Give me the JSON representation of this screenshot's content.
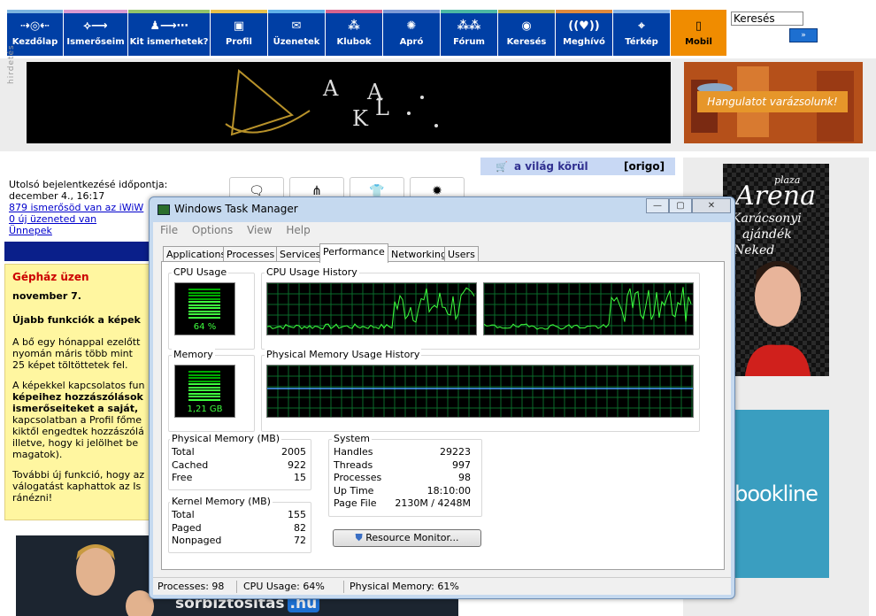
{
  "nav": {
    "items": [
      {
        "label": "Kezdőlap",
        "icon": "home-icon",
        "glyph": "⇢◎⇠"
      },
      {
        "label": "Ismerőseim",
        "icon": "friends-icon",
        "glyph": "⟡⟶"
      },
      {
        "label": "Kit ismerhetek?",
        "icon": "people-network-icon",
        "glyph": "♟⟶⋯"
      },
      {
        "label": "Profil",
        "icon": "profile-icon",
        "glyph": "▣"
      },
      {
        "label": "Üzenetek",
        "icon": "envelope-icon",
        "glyph": "✉"
      },
      {
        "label": "Klubok",
        "icon": "clubs-icon",
        "glyph": "⁂"
      },
      {
        "label": "Apró",
        "icon": "classifieds-icon",
        "glyph": "✺"
      },
      {
        "label": "Fórum",
        "icon": "forum-icon",
        "glyph": "⁂⁂"
      },
      {
        "label": "Keresés",
        "icon": "search-eye-icon",
        "glyph": "◉"
      },
      {
        "label": "Meghívó",
        "icon": "invite-icon",
        "glyph": "((♥))"
      },
      {
        "label": "Térkép",
        "icon": "map-icon",
        "glyph": "⌖"
      },
      {
        "label": "Mobil",
        "icon": "mobile-icon",
        "glyph": "▯"
      }
    ],
    "stripe_colors": [
      "#7bb3df",
      "#d99ad0",
      "#92c46a",
      "#e8c14a",
      "#5fb0e8",
      "#d6658e",
      "#7d9ad6",
      "#4cb8a3",
      "#b6b04a",
      "#e08a3c",
      "#8ab6e6",
      "#f08c00"
    ]
  },
  "search": {
    "value": "Keresés",
    "button": "»"
  },
  "ads": {
    "side_label": "hirdetés",
    "banner_left_text": [
      "A",
      "A",
      "K",
      "L"
    ],
    "banner_right_text": "Hangulatot varázsolunk!",
    "arena_text": "Arena",
    "arena_sub": "plaza",
    "arena_line2": "Karácsonyi",
    "arena_line3": "ajándék",
    "arena_line4": "Neked",
    "bookline": "bookline",
    "bottom_text": "sorbiztosítás",
    "bottom_domain": ".hu"
  },
  "user": {
    "last_login_label": "Utolsó bejelentkezésé időpontja:",
    "last_login_date": "december 4., 16:17",
    "friends_link": "879 ismerősöd van az iWiW",
    "messages_link": "0 új üzeneted van",
    "holidays_link": "Ünnepek"
  },
  "notice": {
    "title": "Gépház üzen",
    "date": "november 7.",
    "headline": "Újabb funkciók a képek",
    "p1": "A bő egy hónappal ezelőtt nyomán máris több mint 25 képet töltöttetek fel.",
    "p2a": "A képekkel kapcsolatos fun",
    "p2b": "képeihez hozzászólások",
    "p2c": "ismerőseiteket a saját,",
    "p2d": "kapcsolatban a Profil főme kiktől engedtek hozzászólá illetve, hogy ki jelölhet be magatok).",
    "p3": "További új funkció, hogy az válogatást kaphattok az Is ránézni!"
  },
  "world": {
    "title": "a világ körül",
    "source": "[origo]"
  },
  "taskmanager": {
    "title": "Windows Task Manager",
    "menu": [
      "File",
      "Options",
      "View",
      "Help"
    ],
    "tabs": [
      "Applications",
      "Processes",
      "Services",
      "Performance",
      "Networking",
      "Users"
    ],
    "active_tab": "Performance",
    "cpu_usage_label": "CPU Usage",
    "cpu_usage_value": "64 %",
    "cpu_fraction": 0.64,
    "cpu_history_label": "CPU Usage History",
    "memory_label": "Memory",
    "memory_value": "1,21 GB",
    "memory_fraction": 0.61,
    "phys_history_label": "Physical Memory Usage History",
    "physical_memory": {
      "heading": "Physical Memory (MB)",
      "rows": [
        {
          "label": "Total",
          "value": "2005"
        },
        {
          "label": "Cached",
          "value": "922"
        },
        {
          "label": "Free",
          "value": "15"
        }
      ]
    },
    "kernel_memory": {
      "heading": "Kernel Memory (MB)",
      "rows": [
        {
          "label": "Total",
          "value": "155"
        },
        {
          "label": "Paged",
          "value": "82"
        },
        {
          "label": "Nonpaged",
          "value": "72"
        }
      ]
    },
    "system": {
      "heading": "System",
      "rows": [
        {
          "label": "Handles",
          "value": "29223"
        },
        {
          "label": "Threads",
          "value": "997"
        },
        {
          "label": "Processes",
          "value": "98"
        },
        {
          "label": "Up Time",
          "value": "18:10:00"
        },
        {
          "label": "Page File",
          "value": "2130M / 4248M"
        }
      ]
    },
    "resource_monitor_button": "Resource Monitor...",
    "status": {
      "processes": "Processes: 98",
      "cpu": "CPU Usage: 64%",
      "memory": "Physical Memory: 61%"
    }
  }
}
